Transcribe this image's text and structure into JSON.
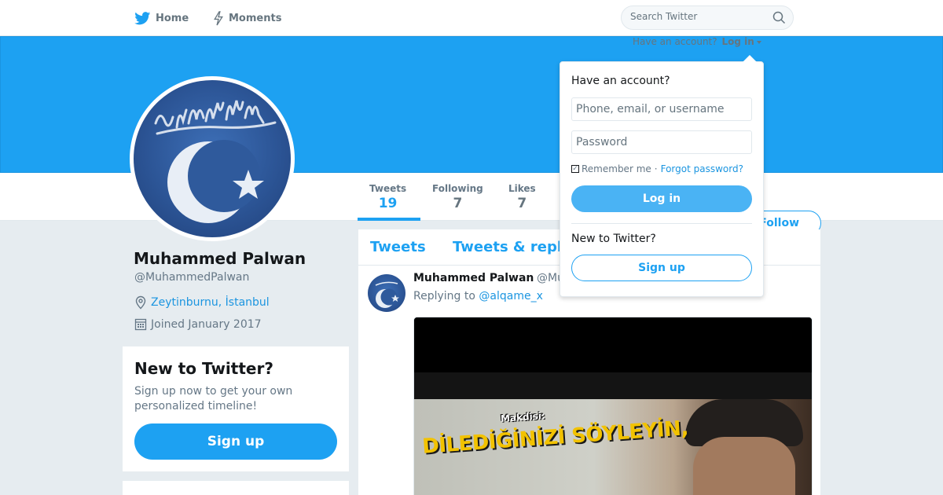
{
  "nav": {
    "home_label": "Home",
    "moments_label": "Moments",
    "search_placeholder": "Search Twitter",
    "home_icon": "twitter-bird-icon",
    "moments_icon": "lightning-bolt-icon",
    "search_icon": "magnifier-icon"
  },
  "account_bar": {
    "prompt": "Have an account?",
    "login_label": "Log in"
  },
  "stats": [
    {
      "label": "Tweets",
      "value": "19"
    },
    {
      "label": "Following",
      "value": "7"
    },
    {
      "label": "Likes",
      "value": "7"
    }
  ],
  "follow_label": "Follow",
  "profile": {
    "name": "Muhammed Palwan",
    "handle": "@MuhammedPalwan",
    "location": "Zeytinburnu, İstanbul",
    "joined": "Joined January 2017",
    "location_icon": "location-pin-icon",
    "calendar_icon": "calendar-icon"
  },
  "signup_card": {
    "title": "New to Twitter?",
    "text": "Sign up now to get your own personalized timeline!",
    "button": "Sign up"
  },
  "timeline": {
    "tabs": [
      "Tweets",
      "Tweets & repl"
    ],
    "tweet": {
      "name": "Muhammed Palwan",
      "handle": "@Mu",
      "replying_prefix": "Replying to",
      "replying_to": "@alqame_x",
      "media_caption_small": "Makdisi:",
      "media_caption_big": "DİLEDİĞİNİZİ SÖYLEYİN,"
    }
  },
  "login_dropdown": {
    "title": "Have an account?",
    "username_placeholder": "Phone, email, or username",
    "password_placeholder": "Password",
    "remember_label": "Remember me",
    "separator": "·",
    "forgot_label": "Forgot password?",
    "login_button": "Log in",
    "new_prompt": "New to Twitter?",
    "signup_button": "Sign up"
  },
  "colors": {
    "brand_blue": "#1da1f2",
    "link_blue": "#1b95e0",
    "banner_blue": "#1da1f2",
    "login_button": "#4ab3f4"
  }
}
